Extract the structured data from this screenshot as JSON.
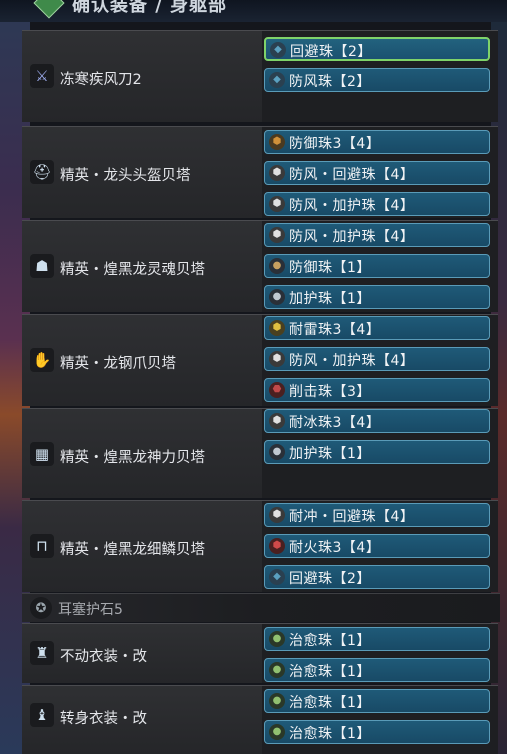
{
  "header": {
    "title": "确认装备 / 身躯部"
  },
  "gear": [
    {
      "name": "冻寒疾风刀2",
      "icon": "weapon-icon",
      "decorations": [
        {
          "label": "回避珠【2】",
          "icon": "jewel-lv2-icon",
          "color": "#5aa0c0"
        },
        {
          "label": "防风珠【2】",
          "icon": "jewel-lv2-icon",
          "color": "#5aa0c0"
        }
      ]
    },
    {
      "name": "精英・龙头头盔贝塔",
      "icon": "helmet-icon",
      "decorations": [
        {
          "label": "防御珠3【4】",
          "icon": "jewel-lv4-icon",
          "color": "#d0913a"
        },
        {
          "label": "防风・回避珠【4】",
          "icon": "jewel-lv4-icon",
          "color": "#e0e0e0"
        },
        {
          "label": "防风・加护珠【4】",
          "icon": "jewel-lv4-icon",
          "color": "#e0e0e0"
        }
      ]
    },
    {
      "name": "精英・煌黑龙灵魂贝塔",
      "icon": "chest-icon",
      "decorations": [
        {
          "label": "防风・加护珠【4】",
          "icon": "jewel-lv4-icon",
          "color": "#e0e0e0"
        },
        {
          "label": "防御珠【1】",
          "icon": "jewel-lv1-icon",
          "color": "#c8a060"
        },
        {
          "label": "加护珠【1】",
          "icon": "jewel-lv1-icon",
          "color": "#c0c8d0"
        }
      ]
    },
    {
      "name": "精英・龙钢爪贝塔",
      "icon": "arms-icon",
      "decorations": [
        {
          "label": "耐雷珠3【4】",
          "icon": "jewel-lv4-icon",
          "color": "#e0c040"
        },
        {
          "label": "防风・加护珠【4】",
          "icon": "jewel-lv4-icon",
          "color": "#e0e0e0"
        },
        {
          "label": "削击珠【3】",
          "icon": "jewel-lv3-icon",
          "color": "#c04a4a"
        }
      ]
    },
    {
      "name": "精英・煌黑龙神力贝塔",
      "icon": "waist-icon",
      "decorations": [
        {
          "label": "耐冰珠3【4】",
          "icon": "jewel-lv4-icon",
          "color": "#e0e0e0"
        },
        {
          "label": "加护珠【1】",
          "icon": "jewel-lv1-icon",
          "color": "#c0c8d0"
        }
      ]
    },
    {
      "name": "精英・煌黑龙细鳞贝塔",
      "icon": "legs-icon",
      "decorations": [
        {
          "label": "耐冲・回避珠【4】",
          "icon": "jewel-lv4-icon",
          "color": "#e0e0e0"
        },
        {
          "label": "耐火珠3【4】",
          "icon": "jewel-lv4-icon",
          "color": "#d04a4a"
        },
        {
          "label": "回避珠【2】",
          "icon": "jewel-lv2-icon",
          "color": "#5aa0c0"
        }
      ]
    },
    {
      "name": "不动衣装・改",
      "icon": "mantle-icon",
      "decorations": [
        {
          "label": "治愈珠【1】",
          "icon": "jewel-lv1-icon",
          "color": "#90c070"
        },
        {
          "label": "治愈珠【1】",
          "icon": "jewel-lv1-icon",
          "color": "#90c070"
        }
      ]
    },
    {
      "name": "转身衣装・改",
      "icon": "mantle-icon",
      "decorations": [
        {
          "label": "治愈珠【1】",
          "icon": "jewel-lv1-icon",
          "color": "#90c070"
        },
        {
          "label": "治愈珠【1】",
          "icon": "jewel-lv1-icon",
          "color": "#90c070"
        }
      ]
    }
  ],
  "charm": {
    "name": "耳塞护石5",
    "icon": "charm-icon"
  }
}
